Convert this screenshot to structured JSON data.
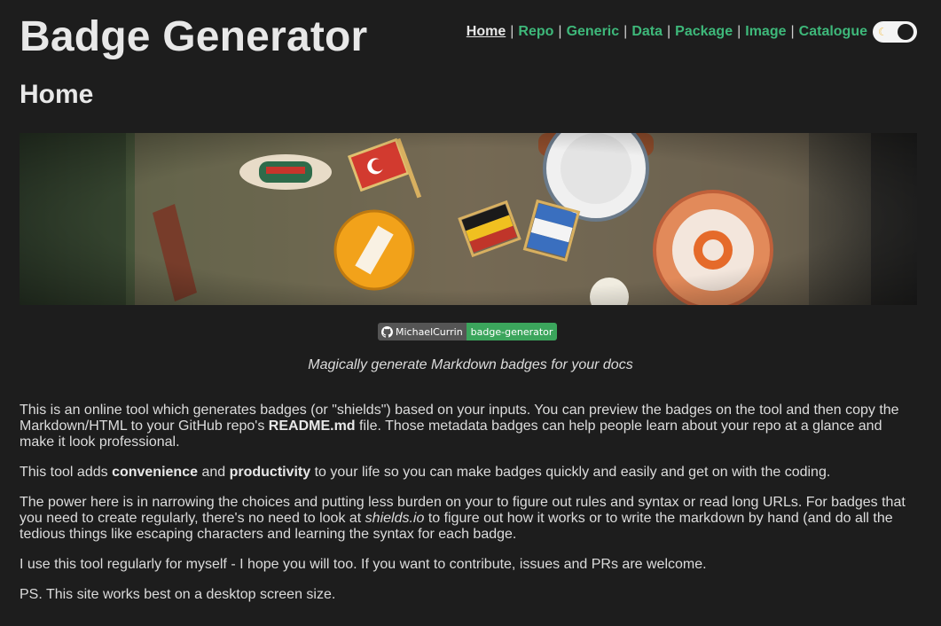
{
  "header": {
    "site_title": "Badge Generator",
    "nav": [
      {
        "label": "Home",
        "active": true
      },
      {
        "label": "Repo",
        "active": false
      },
      {
        "label": "Generic",
        "active": false
      },
      {
        "label": "Data",
        "active": false
      },
      {
        "label": "Package",
        "active": false
      },
      {
        "label": "Image",
        "active": false
      },
      {
        "label": "Catalogue",
        "active": false
      }
    ],
    "separator": "|",
    "theme_toggle": {
      "icon": "moon-icon",
      "state": "dark"
    }
  },
  "main": {
    "heading": "Home",
    "badge": {
      "icon": "github-icon",
      "left_label": "MichaelCurrin",
      "right_label": "badge-generator",
      "right_color": "#3ba55c"
    },
    "tagline": "Magically generate Markdown badges for your docs",
    "paragraphs": {
      "p1_a": "This is an online tool which generates badges (or \"shields\") based on your inputs. You can preview the badges on the tool and then copy the Markdown/HTML to your GitHub repo's ",
      "p1_b": "README.md",
      "p1_c": " file. Those metadata badges can help people learn about your repo at a glance and make it look professional.",
      "p2_a": "This tool adds ",
      "p2_b": "convenience",
      "p2_c": " and ",
      "p2_d": "productivity",
      "p2_e": " to your life so you can make badges quickly and easily and get on with the coding.",
      "p3_a": "The power here is in narrowing the choices and putting less burden on your to figure out rules and syntax or read long URLs. For badges that you need to create regularly, there's no need to look at ",
      "p3_b": "shields.io",
      "p3_c": " to figure out how it works or to write the markdown by hand (and do all the tedious things like escaping characters and learning the syntax for each badge.",
      "p4": "I use this tool regularly for myself - I hope you will too. If you want to contribute, issues and PRs are welcome.",
      "p5": "PS. This site works best on a desktop screen size."
    }
  },
  "colors": {
    "background": "#1d1d1d",
    "link": "#3eb87a",
    "text": "#dcdcdc"
  }
}
